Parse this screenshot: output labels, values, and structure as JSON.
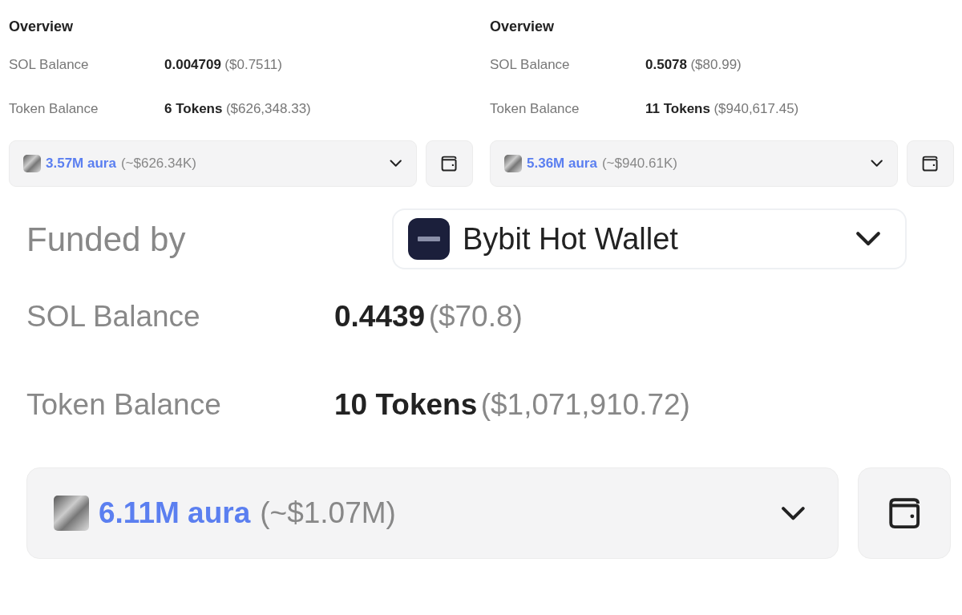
{
  "overviews": [
    {
      "title": "Overview",
      "rows": [
        {
          "label": "SOL Balance",
          "value": "0.004709",
          "usd": "($0.7511)"
        },
        {
          "label": "Token Balance",
          "value": "6 Tokens",
          "usd": "($626,348.33)"
        }
      ],
      "token": {
        "amount": "3.57M aura",
        "usd": "(~$626.34K)"
      }
    },
    {
      "title": "Overview",
      "rows": [
        {
          "label": "SOL Balance",
          "value": "0.5078",
          "usd": "($80.99)"
        },
        {
          "label": "Token Balance",
          "value": "11 Tokens",
          "usd": "($940,617.45)"
        }
      ],
      "token": {
        "amount": "5.36M aura",
        "usd": "(~$940.61K)"
      }
    }
  ],
  "funded": {
    "label": "Funded by",
    "funder": "Bybit Hot Wallet",
    "rows": [
      {
        "label": "SOL Balance",
        "value": "0.4439",
        "usd": "($70.8)"
      },
      {
        "label": "Token Balance",
        "value": "10 Tokens",
        "usd": "($1,071,910.72)"
      }
    ],
    "token": {
      "amount": "6.11M aura",
      "usd": "(~$1.07M)"
    }
  }
}
